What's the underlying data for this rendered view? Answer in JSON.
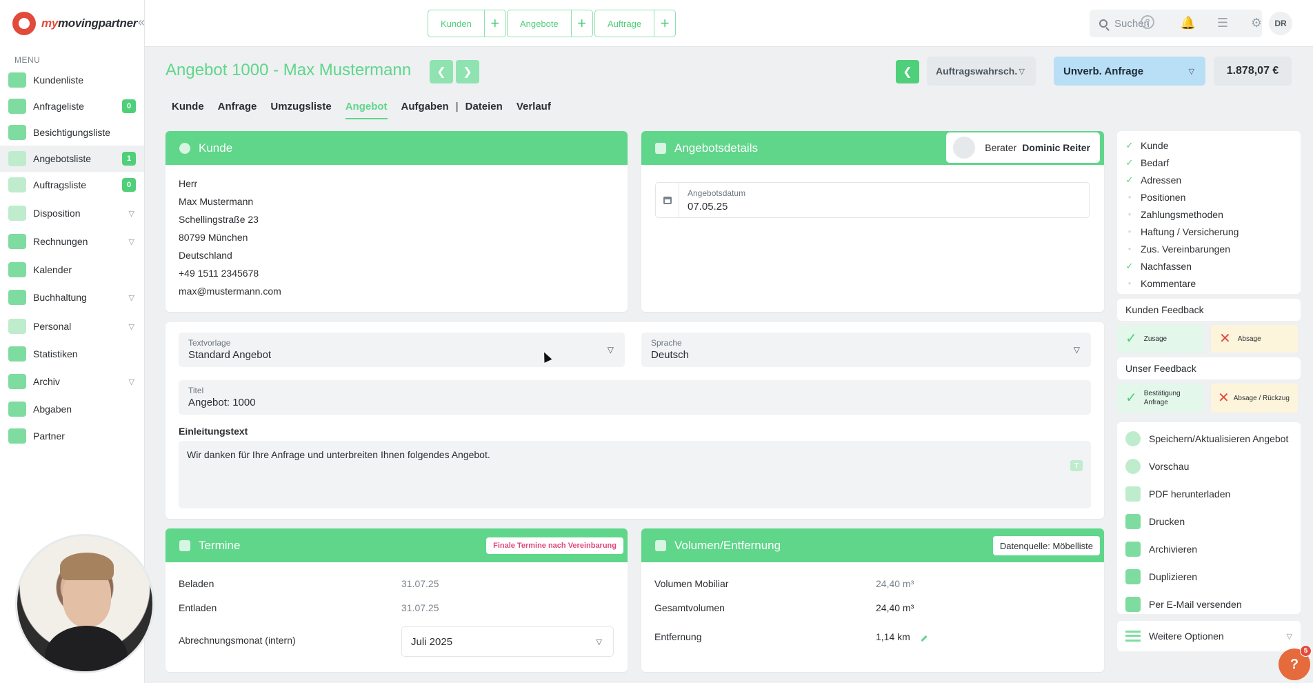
{
  "brand": {
    "name_left": "my",
    "name_right": "movingpartner"
  },
  "sidebar": {
    "menu_label": "MENU",
    "items": [
      {
        "label": "Kundenliste"
      },
      {
        "label": "Anfrageliste",
        "badge": "0"
      },
      {
        "label": "Besichtigungsliste"
      },
      {
        "label": "Angebotsliste",
        "badge": "1"
      },
      {
        "label": "Auftragsliste",
        "badge": "0"
      },
      {
        "label": "Disposition"
      },
      {
        "label": "Rechnungen"
      },
      {
        "label": "Kalender"
      },
      {
        "label": "Buchhaltung"
      },
      {
        "label": "Personal"
      },
      {
        "label": "Statistiken"
      },
      {
        "label": "Archiv"
      },
      {
        "label": "Abgaben"
      },
      {
        "label": "Partner"
      }
    ]
  },
  "topbar": {
    "quick": [
      {
        "label": "Kunden"
      },
      {
        "label": "Angebote"
      },
      {
        "label": "Aufträge"
      }
    ],
    "search_placeholder": "Suchen",
    "avatar_initials": "DR"
  },
  "header": {
    "title": "Angebot 1000 - Max Mustermann",
    "probability_label": "Auftragswahrsch.",
    "status": "Unverb. Anfrage",
    "price": "1.878,07 €"
  },
  "tabs": [
    "Kunde",
    "Anfrage",
    "Umzugsliste",
    "Angebot",
    "Aufgaben",
    "Dateien",
    "Verlauf"
  ],
  "customer_card": {
    "title": "Kunde",
    "lines": [
      "Herr",
      "Max Mustermann",
      "Schellingstraße 23",
      "80799 München",
      "Deutschland",
      "+49 1511 2345678",
      "max@mustermann.com"
    ]
  },
  "offer_card": {
    "title": "Angebotsdetails",
    "advisor_label": "Berater",
    "advisor_name": "Dominic Reiter",
    "date_label": "Angebotsdatum",
    "date_value": "07.05.25"
  },
  "text_card": {
    "template_label": "Textvorlage",
    "template_value": "Standard Angebot",
    "language_label": "Sprache",
    "language_value": "Deutsch",
    "title_label": "Titel",
    "title_value": "Angebot: 1000",
    "intro_label": "Einleitungstext",
    "intro_value": "Wir danken für Ihre Anfrage und unterbreiten Ihnen folgendes Angebot.",
    "text_icon": "T"
  },
  "termine_card": {
    "title": "Termine",
    "note": "Finale Termine nach Vereinbarung",
    "rows": [
      {
        "label": "Beladen",
        "value": "31.07.25"
      },
      {
        "label": "Entladen",
        "value": "31.07.25"
      }
    ],
    "billing_label": "Abrechnungsmonat (intern)",
    "billing_value": "Juli 2025"
  },
  "volume_card": {
    "title": "Volumen/Entfernung",
    "source": "Datenquelle: Möbelliste",
    "rows": [
      {
        "label": "Volumen Mobiliar",
        "value": "24,40 m³"
      },
      {
        "label": "Gesamtvolumen",
        "value": "24,40 m³"
      },
      {
        "label": "Entfernung",
        "value": "1,14 km"
      }
    ]
  },
  "checklist": [
    {
      "label": "Kunde",
      "done": true
    },
    {
      "label": "Bedarf",
      "done": true
    },
    {
      "label": "Adressen",
      "done": true
    },
    {
      "label": "Positionen",
      "done": false
    },
    {
      "label": "Zahlungsmethoden",
      "done": false
    },
    {
      "label": "Haftung / Versicherung",
      "done": false
    },
    {
      "label": "Zus. Vereinbarungen",
      "done": false
    },
    {
      "label": "Nachfassen",
      "done": true
    },
    {
      "label": "Kommentare",
      "done": false
    }
  ],
  "feedback": {
    "customer_label": "Kunden Feedback",
    "accept": "Zusage",
    "decline": "Absage",
    "our_label": "Unser Feedback",
    "confirm_line1": "Bestätigung",
    "confirm_line2": "Anfrage",
    "withdraw": "Absage / Rückzug"
  },
  "actions": [
    {
      "label": "Speichern/Aktualisieren Angebot"
    },
    {
      "label": "Vorschau"
    },
    {
      "label": "PDF herunterladen"
    },
    {
      "label": "Drucken"
    },
    {
      "label": "Archivieren"
    },
    {
      "label": "Duplizieren"
    },
    {
      "label": "Per E-Mail versenden"
    }
  ],
  "more_options": "Weitere Optionen",
  "help": {
    "icon": "?",
    "count": "5"
  },
  "colors": {
    "accent": "#5fd68a",
    "status_blue": "#b8dff6",
    "note_pink": "#e0487a"
  }
}
